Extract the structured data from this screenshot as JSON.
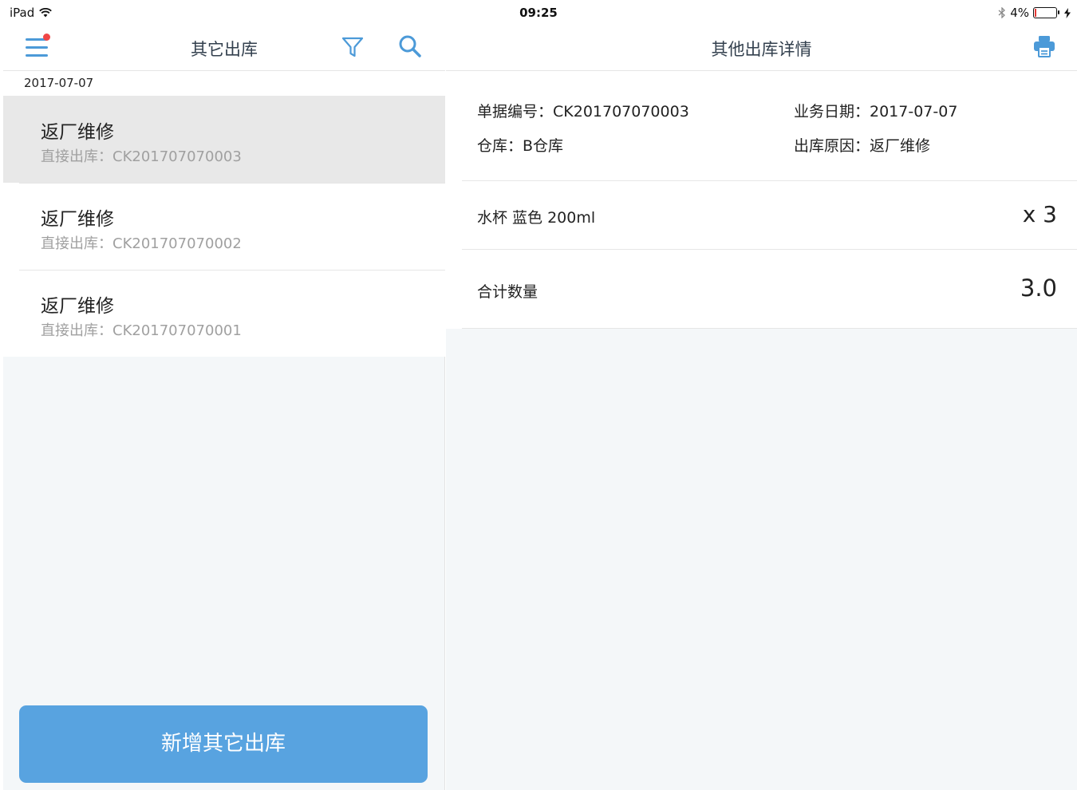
{
  "status_bar": {
    "device": "iPad",
    "time": "09:25",
    "battery_percent": "4%"
  },
  "left": {
    "title": "其它出库",
    "date_group": "2017-07-07",
    "records": [
      {
        "title": "返厂维修",
        "subtitle": "直接出库：CK201707070003",
        "selected": true
      },
      {
        "title": "返厂维修",
        "subtitle": "直接出库：CK201707070002",
        "selected": false
      },
      {
        "title": "返厂维修",
        "subtitle": "直接出库：CK201707070001",
        "selected": false
      }
    ],
    "add_button": "新增其它出库"
  },
  "right": {
    "title": "其他出库详情",
    "doc_number": "单据编号：CK201707070003",
    "business_date": "业务日期：2017-07-07",
    "warehouse": "仓库：B仓库",
    "reason": "出库原因：返厂维修",
    "item": {
      "name": "水杯 蓝色 200ml",
      "qty": "x 3"
    },
    "total": {
      "label": "合计数量",
      "value": "3.0"
    }
  },
  "colors": {
    "accent": "#58a3e0",
    "icon": "#4c9ad8",
    "badge": "#f04646",
    "pane_bg": "#f4f7f9",
    "selected_row": "#e8e8e8"
  },
  "icons": [
    "wifi-icon",
    "bluetooth-icon",
    "battery-icon",
    "charging-icon",
    "menu-icon",
    "filter-icon",
    "search-icon",
    "print-icon"
  ]
}
